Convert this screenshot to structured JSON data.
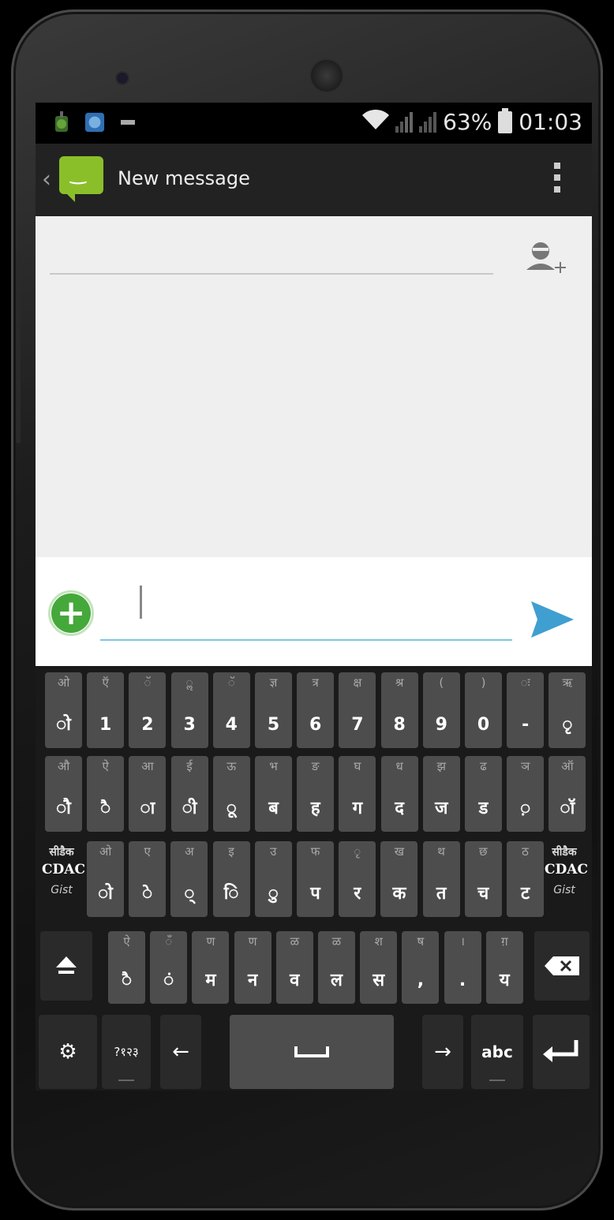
{
  "status_bar": {
    "battery_percent": "63%",
    "time": "01:03",
    "notification_icons": [
      "download-icon",
      "app-icon",
      "minus-icon"
    ],
    "wifi": "wifi-icon",
    "signal": [
      "signal-icon",
      "signal-no-sim-icon"
    ]
  },
  "action_bar": {
    "title": "New message",
    "app_icon": "messaging-smiley-icon"
  },
  "compose": {
    "to_placeholder": "",
    "message_placeholder": ""
  },
  "keyboard": {
    "row1": [
      {
        "hint": "ओ",
        "main": "ो"
      },
      {
        "hint": "ऍ",
        "main": "1"
      },
      {
        "hint": "ॅ",
        "main": "2"
      },
      {
        "hint": "ॢ",
        "main": "3"
      },
      {
        "hint": "ॅ",
        "main": "4"
      },
      {
        "hint": "ज्ञ",
        "main": "5"
      },
      {
        "hint": "त्र",
        "main": "6"
      },
      {
        "hint": "क्ष",
        "main": "7"
      },
      {
        "hint": "श्र",
        "main": "8"
      },
      {
        "hint": "(",
        "main": "9"
      },
      {
        "hint": ")",
        "main": "0"
      },
      {
        "hint": "ः",
        "main": "-"
      },
      {
        "hint": "ऋ",
        "main": "ृ"
      }
    ],
    "row2": [
      {
        "hint": "औ",
        "main": "ौ"
      },
      {
        "hint": "ऐ",
        "main": "ै"
      },
      {
        "hint": "आ",
        "main": "ा"
      },
      {
        "hint": "ई",
        "main": "ी"
      },
      {
        "hint": "ऊ",
        "main": "ू"
      },
      {
        "hint": "भ",
        "main": "ब"
      },
      {
        "hint": "ङ",
        "main": "ह"
      },
      {
        "hint": "घ",
        "main": "ग"
      },
      {
        "hint": "ध",
        "main": "द"
      },
      {
        "hint": "झ",
        "main": "ज"
      },
      {
        "hint": "ढ",
        "main": "ड"
      },
      {
        "hint": "ञ",
        "main": "़"
      },
      {
        "hint": "ऑ",
        "main": "ॉ"
      }
    ],
    "row3_side": {
      "c1": "सीडैक",
      "c2": "CDAC",
      "c3": "Gist"
    },
    "row3": [
      {
        "hint": "ओ",
        "main": "ो"
      },
      {
        "hint": "ए",
        "main": "े"
      },
      {
        "hint": "अ",
        "main": "्"
      },
      {
        "hint": "इ",
        "main": "ि"
      },
      {
        "hint": "उ",
        "main": "ु"
      },
      {
        "hint": "फ",
        "main": "प"
      },
      {
        "hint": "ृ",
        "main": "र"
      },
      {
        "hint": "ख",
        "main": "क"
      },
      {
        "hint": "थ",
        "main": "त"
      },
      {
        "hint": "छ",
        "main": "च"
      },
      {
        "hint": "ठ",
        "main": "ट"
      }
    ],
    "row4": [
      {
        "hint": "ऐ",
        "main": "ै"
      },
      {
        "hint": "ँ",
        "main": "ं"
      },
      {
        "hint": "ण",
        "main": "म"
      },
      {
        "hint": "ण",
        "main": "न"
      },
      {
        "hint": "ळ",
        "main": "व"
      },
      {
        "hint": "ळ",
        "main": "ल"
      },
      {
        "hint": "श",
        "main": "स"
      },
      {
        "hint": "ष",
        "main": ","
      },
      {
        "hint": "।",
        "main": "."
      },
      {
        "hint": "ग़",
        "main": "य"
      }
    ],
    "row5": {
      "settings": "⚙",
      "numbers_label": "?१२३",
      "left_arrow": "←",
      "right_arrow": "→",
      "abc_label": "abc"
    }
  },
  "colors": {
    "accent_green": "#45a83b",
    "send_blue": "#3f9fd0",
    "app_icon_green": "#8bbf2a"
  }
}
